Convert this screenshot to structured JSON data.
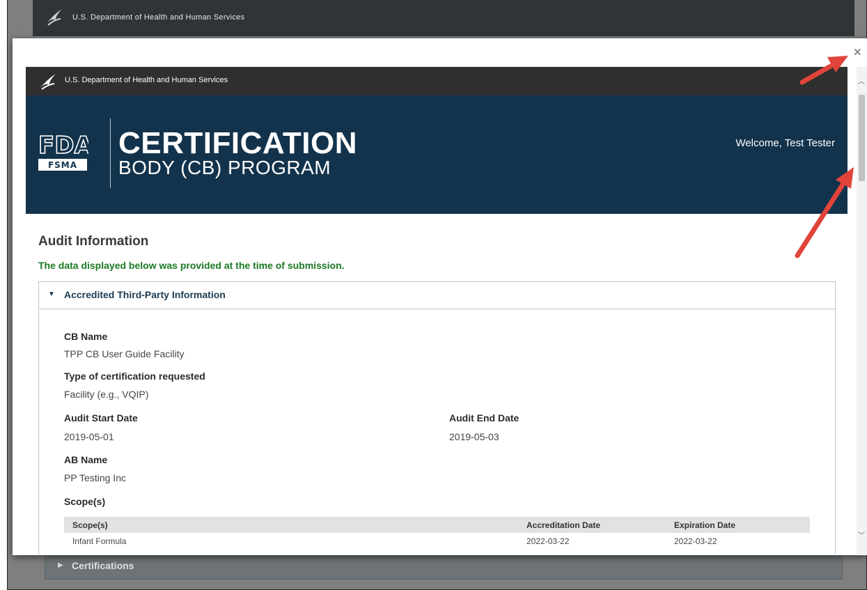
{
  "background": {
    "agency_label": "U.S. Department of Health and Human Services",
    "collapsed_section_label": "Certifications",
    "colors": {
      "overlay": "#7f7f7f",
      "header": "#2f3437"
    }
  },
  "modal": {
    "close_icon": "close-icon",
    "header": {
      "agency_label": "U.S. Department of Health and Human Services",
      "fda_mark": "FDA",
      "fsma_mark": "FSMA",
      "program_title": "CERTIFICATION",
      "program_subtitle": "BODY (CB) PROGRAM",
      "welcome_text": "Welcome, Test Tester"
    },
    "page_title": "Audit Information",
    "notice": "The data displayed below was provided at the time of submission.",
    "section": {
      "title": "Accredited Third-Party Information",
      "fields": {
        "cb_name_label": "CB Name",
        "cb_name_value": "TPP CB User Guide Facility",
        "cert_type_label": "Type of certification requested",
        "cert_type_value": "Facility (e.g., VQIP)",
        "start_label": "Audit Start Date",
        "start_value": "2019-05-01",
        "end_label": "Audit End Date",
        "end_value": "2019-05-03",
        "ab_name_label": "AB Name",
        "ab_name_value": "PP Testing Inc",
        "scopes_label": "Scope(s)"
      },
      "scope_table": {
        "columns": [
          "Scope(s)",
          "Accreditation Date",
          "Expiration Date"
        ],
        "rows": [
          [
            "Infant Formula",
            "2022-03-22",
            "2022-03-22"
          ]
        ]
      }
    },
    "colors": {
      "banner": "#13334c",
      "notice": "#1b7a24",
      "arrows": "#e0443a"
    }
  }
}
